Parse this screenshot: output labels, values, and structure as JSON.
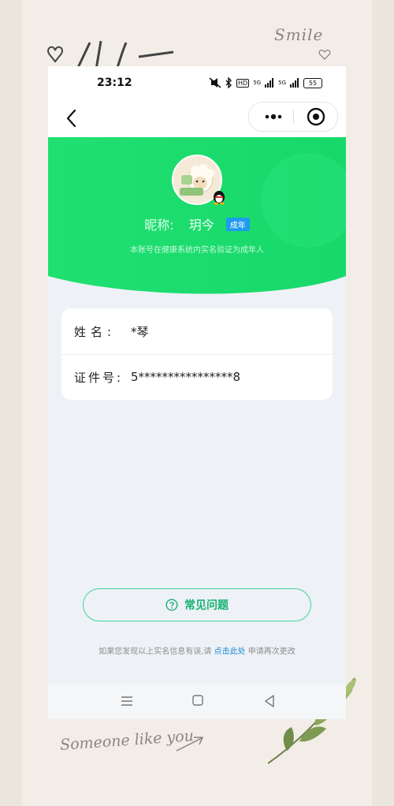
{
  "status_bar": {
    "time": "23:12",
    "indicators": [
      "mute-icon",
      "bluetooth-icon",
      "HD",
      "5G",
      "5G"
    ],
    "hd_label": "HD",
    "network_1": "5G",
    "network_2": "5G",
    "battery": "55"
  },
  "profile": {
    "nickname_label": "昵称:",
    "nickname": "玥今",
    "age_badge": "成年",
    "verify_note": "本账号在健康系统内实名验证为成年人"
  },
  "identity": {
    "name_label": "姓名:",
    "name_value": "*琴",
    "id_label": "证件号:",
    "id_value": "5****************8"
  },
  "faq": {
    "label": "常见问题"
  },
  "footer": {
    "prefix": "如果您发现以上实名信息有误,请",
    "link": "点击此处",
    "suffix": "申请再次更改"
  },
  "decorations": {
    "smile": "Smile",
    "someone": "Someone like you"
  },
  "colors": {
    "hero_green": "#1fe075",
    "accent_green": "#18b274",
    "link_blue": "#1b8bd6",
    "badge_blue": "#1e9bf0"
  }
}
